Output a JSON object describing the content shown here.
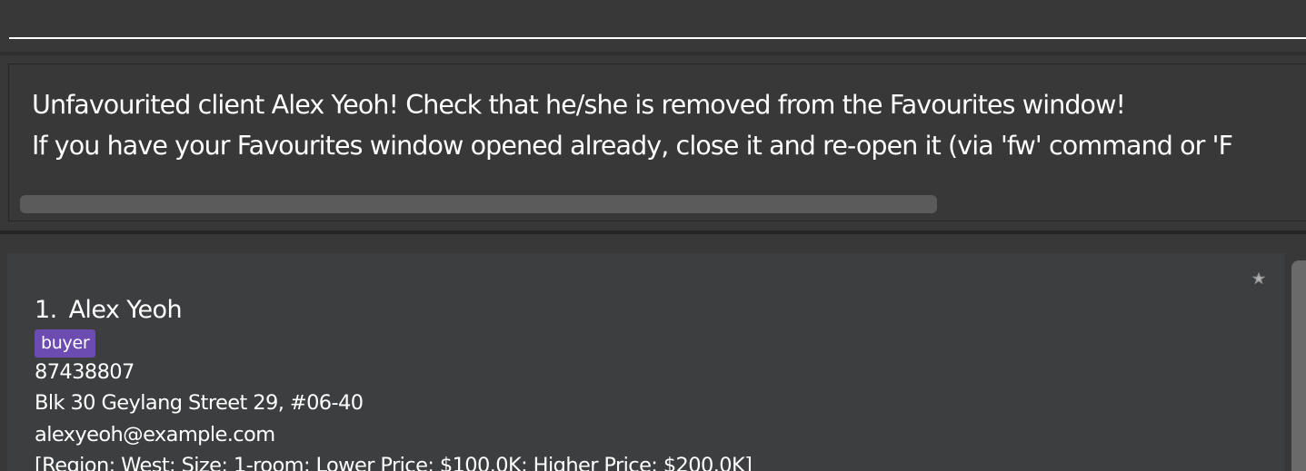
{
  "command_box": {
    "value": ""
  },
  "result_display": {
    "line1": "Unfavourited client Alex Yeoh! Check that he/she is removed from the Favourites window!",
    "line2": "If you have your Favourites window opened already, close it and re-open it (via 'fw' command or 'F"
  },
  "person_list": {
    "items": [
      {
        "index": "1.",
        "name": "Alex Yeoh",
        "tag": "buyer",
        "phone": "87438807",
        "address": "Blk 30 Geylang Street 29, #06-40",
        "email": "alexyeoh@example.com",
        "preference": "[Region: West; Size: 1-room; Lower Price: $100.0K; Higher Price: $200.0K]",
        "favourite_icon": "favourite-star-icon"
      }
    ]
  },
  "colors": {
    "background": "#383838",
    "card": "#3c3e3f",
    "tag": "#6c4cb1",
    "text": "#ffffff",
    "scrollbar": "#5b5b5b"
  }
}
